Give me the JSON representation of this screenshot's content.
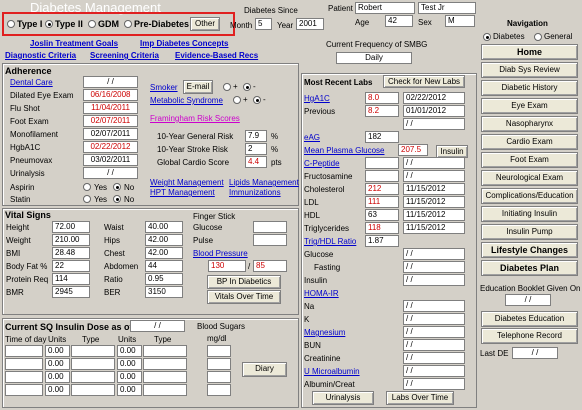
{
  "title": "Diabetes Management",
  "type_options": [
    "Type I",
    "Type II",
    "GDM",
    "Pre-Diabetes",
    "Other"
  ],
  "header": {
    "month_label": "Month",
    "month": "5",
    "year_label": "Year",
    "year": "2001",
    "since_label": "Diabetes Since",
    "patient_label": "Patient",
    "patient_first": "Robert",
    "patient_last": "Test Jr",
    "age_label": "Age",
    "age": "42",
    "sex_label": "Sex",
    "sex": "M"
  },
  "links": {
    "joslin": "Joslin Treatment Goals",
    "imp": "Imp Diabetes Concepts",
    "diagnostic": "Diagnostic Criteria",
    "screening": "Screening Criteria",
    "evidence": "Evidence-Based Recs"
  },
  "smbg": {
    "label": "Current Frequency of SMBG",
    "value": "Daily"
  },
  "adherence": {
    "title": "Adherence",
    "rows": [
      {
        "label": "Dental Care",
        "value": "/ /",
        "red": false,
        "link": true
      },
      {
        "label": "Dilated Eye Exam",
        "value": "06/16/2008",
        "red": true,
        "link": false
      },
      {
        "label": "Flu Shot",
        "value": "11/04/2011",
        "red": true,
        "link": false
      },
      {
        "label": "Foot Exam",
        "value": "02/07/2011",
        "red": true,
        "link": false
      },
      {
        "label": "Monofilament",
        "value": "02/07/2011",
        "red": false,
        "link": false
      },
      {
        "label": "HgbA1C",
        "value": "02/22/2012",
        "red": true,
        "link": false
      },
      {
        "label": "Pneumovax",
        "value": "03/02/2011",
        "red": false,
        "link": false
      },
      {
        "label": "Urinalysis",
        "value": "/ /",
        "red": false,
        "link": false
      }
    ],
    "aspirin": "Aspirin",
    "statin": "Statin",
    "yes": "Yes",
    "no": "No"
  },
  "smoker": {
    "label": "Smoker",
    "email": "E-mail",
    "plus": "+",
    "minus": "-"
  },
  "metabolic": "Metabolic Syndrome",
  "framingham": {
    "link": "Framingham Risk Scores",
    "general_label": "10-Year General Risk",
    "general": "7.9",
    "pct": "%",
    "stroke_label": "10-Year Stroke Risk",
    "stroke": "2",
    "cardio_label": "Global Cardio Score",
    "cardio": "4.4",
    "pts": "pts"
  },
  "mgmt_links": [
    "Weight Management",
    "Lipids Management",
    "HPT Management",
    "Immunizations"
  ],
  "vitals": {
    "title": "Vital Signs",
    "left": [
      {
        "label": "Height",
        "value": "72.00"
      },
      {
        "label": "Weight",
        "value": "210.00"
      },
      {
        "label": "BMI",
        "value": "28.48"
      },
      {
        "label": "Body Fat %",
        "value": "22"
      },
      {
        "label": "Protein Req",
        "value": "114"
      },
      {
        "label": "BMR",
        "value": "2945"
      }
    ],
    "right": [
      {
        "label": "Waist",
        "value": "40.00"
      },
      {
        "label": "Hips",
        "value": "42.00"
      },
      {
        "label": "Chest",
        "value": "42.00"
      },
      {
        "label": "Abdomen",
        "value": "44"
      },
      {
        "label": "Ratio",
        "value": "0.95"
      },
      {
        "label": "BER",
        "value": "3150"
      }
    ],
    "finger_stick": "Finger Stick",
    "glucose": "Glucose",
    "pulse": "Pulse",
    "bp_link": "Blood Pressure",
    "bp_sys": "130",
    "bp_slash": "/",
    "bp_dia": "85",
    "bp_diabetics": "BP In Diabetics",
    "vitals_over_time": "Vitals Over Time"
  },
  "insulin": {
    "title": "Current SQ Insulin Dose as of",
    "date": "/ /",
    "blood_sugars": "Blood Sugars",
    "mgdl": "mg/dl",
    "cols": [
      "Time of day",
      "Units",
      "Type",
      "Units",
      "Type"
    ],
    "rows": [
      [
        "0.00",
        "0.00"
      ],
      [
        "0.00",
        "0.00"
      ],
      [
        "0.00",
        "0.00"
      ],
      [
        "0.00",
        "0.00"
      ]
    ],
    "diary": "Diary"
  },
  "labs": {
    "title": "Most Recent Labs",
    "check_btn": "Check for New Labs",
    "rows": [
      {
        "label": "HgA1C",
        "link": true,
        "value": "8.0",
        "red": true,
        "date": "02/22/2012"
      },
      {
        "label": "Previous",
        "link": false,
        "value": "8.2",
        "red": true,
        "date": "01/01/2012"
      },
      {
        "label": "",
        "link": false,
        "value": "",
        "red": false,
        "date": "/ /"
      },
      {
        "label": "eAG",
        "link": true,
        "value": "182",
        "red": false,
        "date": ""
      },
      {
        "label": "Mean Plasma Glucose",
        "link": true,
        "value": "207.5",
        "red": true,
        "date": ""
      },
      {
        "label": "C-Peptide",
        "link": true,
        "value": "",
        "red": false,
        "date": "/ /"
      },
      {
        "label": "Fructosamine",
        "link": false,
        "value": "",
        "red": false,
        "date": "/ /"
      },
      {
        "label": "Cholesterol",
        "link": false,
        "value": "212",
        "red": true,
        "date": "11/15/2012"
      },
      {
        "label": "LDL",
        "link": false,
        "value": "111",
        "red": true,
        "date": "11/15/2012"
      },
      {
        "label": "HDL",
        "link": false,
        "value": "63",
        "red": false,
        "date": "11/15/2012"
      },
      {
        "label": "Triglycerides",
        "link": false,
        "value": "118",
        "red": true,
        "date": "11/15/2012"
      },
      {
        "label": "Trig/HDL Ratio",
        "link": true,
        "value": "1.87",
        "red": false,
        "date": ""
      },
      {
        "label": "Glucose",
        "link": false,
        "value": "",
        "red": false,
        "date": "/ /"
      },
      {
        "label": "Fasting",
        "link": false,
        "value": "",
        "red": false,
        "date": "/ /"
      },
      {
        "label": "Insulin",
        "link": false,
        "value": "",
        "red": false,
        "date": "/ /"
      },
      {
        "label": "HOMA-IR",
        "link": true,
        "value": "",
        "red": false,
        "date": ""
      },
      {
        "label": "Na",
        "link": false,
        "value": "",
        "red": false,
        "date": "/ /"
      },
      {
        "label": "K",
        "link": false,
        "value": "",
        "red": false,
        "date": "/ /"
      },
      {
        "label": "Magnesium",
        "link": true,
        "value": "",
        "red": false,
        "date": "/ /"
      },
      {
        "label": "BUN",
        "link": false,
        "value": "",
        "red": false,
        "date": "/ /"
      },
      {
        "label": "Creatinine",
        "link": false,
        "value": "",
        "red": false,
        "date": "/ /"
      },
      {
        "label": "U Microalbumin",
        "link": true,
        "value": "",
        "red": false,
        "date": "/ /"
      },
      {
        "label": "Albumin/Creat",
        "link": false,
        "value": "",
        "red": false,
        "date": "/ /"
      }
    ],
    "insulin_btn": "Insulin",
    "urinalysis_btn": "Urinalysis",
    "labs_over_time_btn": "Labs Over Time"
  },
  "navigation": {
    "title": "Navigation",
    "opt_diabetes": "Diabetes",
    "opt_general": "General",
    "buttons": [
      "Home",
      "Diab Sys Review",
      "Diabetic History",
      "Eye Exam",
      "Nasopharynx",
      "Cardio Exam",
      "Foot Exam",
      "Neurological Exam",
      "Complications/Education",
      "Initiating Insulin",
      "Insulin Pump",
      "Lifestyle Changes",
      "Diabetes Plan"
    ],
    "booklet_label": "Education Booklet Given On",
    "booklet_date": "/ /",
    "education_btn": "Diabetes Education",
    "telephone_btn": "Telephone Record",
    "last_de_label": "Last DE",
    "last_de": "/ /"
  },
  "colors": {
    "highlight_box": "#e02020",
    "link": "#0000cc",
    "alert": "#cc0000",
    "title": "#ffffff"
  }
}
